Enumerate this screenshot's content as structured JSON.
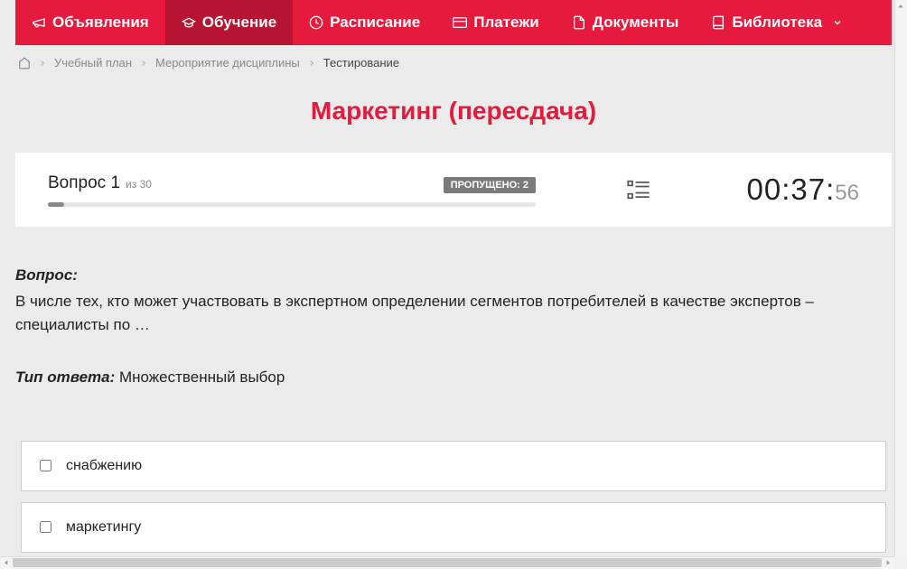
{
  "nav": {
    "items": [
      {
        "label": "Объявления"
      },
      {
        "label": "Обучение"
      },
      {
        "label": "Расписание"
      },
      {
        "label": "Платежи"
      },
      {
        "label": "Документы"
      },
      {
        "label": "Библиотека"
      }
    ]
  },
  "breadcrumb": {
    "items": [
      {
        "label": "Учебный план"
      },
      {
        "label": "Мероприятие дисциплины"
      }
    ],
    "current": "Тестирование"
  },
  "page_title": "Маркетинг (пересдача)",
  "status": {
    "question_word": "Вопрос",
    "question_num": "1",
    "of_word": "из",
    "total": "30",
    "skipped_label": "ПРОПУЩЕНО: 2",
    "timer_main": "00:37:",
    "timer_sec": "56"
  },
  "question": {
    "heading": "Вопрос:",
    "text": "В числе тех, кто может участвовать в экспертном определении сегментов потребителей в качестве экспертов – специалисты по …",
    "answer_type_label": "Тип ответа:",
    "answer_type_value": " Множественный выбор"
  },
  "options": [
    {
      "label": "снабжению"
    },
    {
      "label": "маркетингу"
    }
  ]
}
